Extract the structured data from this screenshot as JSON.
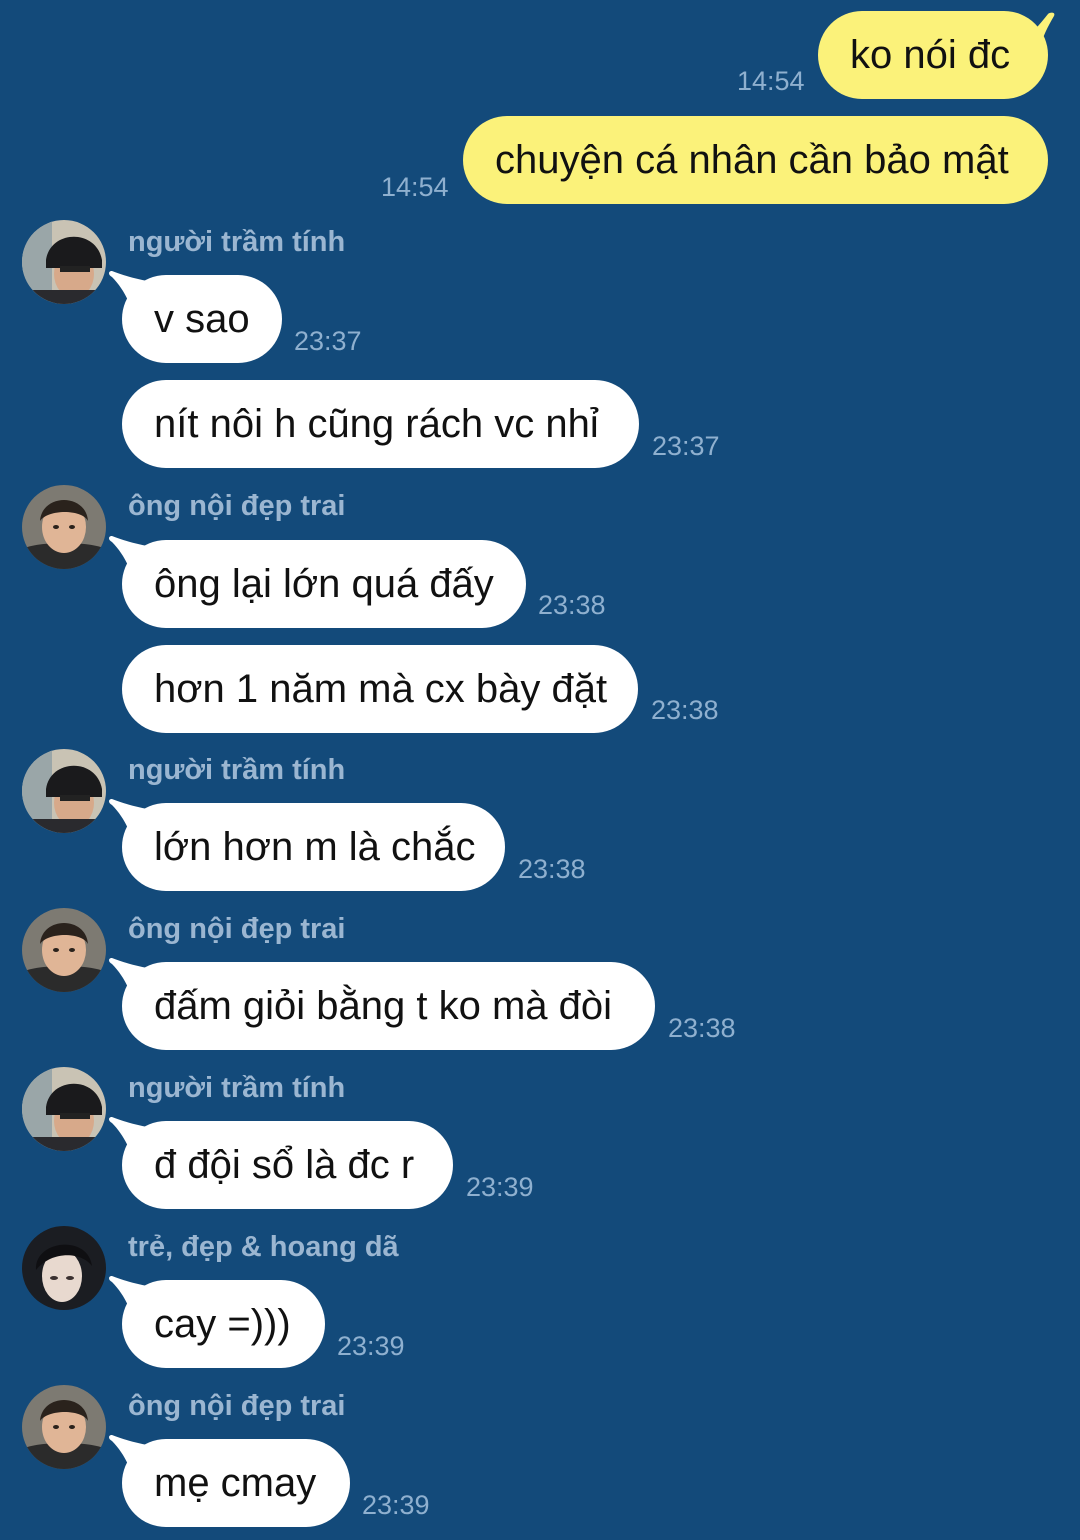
{
  "senders": {
    "a": "người trầm tính",
    "b": "ông nội đẹp trai",
    "c": "trẻ, đẹp & hoang dã"
  },
  "messages": [
    {
      "direction": "out",
      "text": "ko nói đc",
      "time": "14:54"
    },
    {
      "direction": "out",
      "text": "chuyện cá nhân cần bảo mật",
      "time": "14:54"
    },
    {
      "direction": "in",
      "sender": "người trầm tính",
      "text": "v sao",
      "time": "23:37"
    },
    {
      "direction": "in",
      "text": "nít nôi h cũng rách vc nhỉ",
      "time": "23:37"
    },
    {
      "direction": "in",
      "sender": "ông nội đẹp trai",
      "text": "ông lại lớn quá đấy",
      "time": "23:38"
    },
    {
      "direction": "in",
      "text": "hơn 1 năm mà cx bày đặt",
      "time": "23:38"
    },
    {
      "direction": "in",
      "sender": "người trầm tính",
      "text": "lớn hơn m là chắc",
      "time": "23:38"
    },
    {
      "direction": "in",
      "sender": "ông nội đẹp trai",
      "text": "đấm giỏi bằng t ko mà đòi",
      "time": "23:38"
    },
    {
      "direction": "in",
      "sender": "người trầm tính",
      "text": "đ đội sổ là đc r",
      "time": "23:39"
    },
    {
      "direction": "in",
      "sender": "trẻ, đẹp & hoang dã",
      "text": "cay =)))",
      "time": "23:39"
    },
    {
      "direction": "in",
      "sender": "ông nội đẹp trai",
      "text": "mẹ cmay",
      "time": "23:39"
    }
  ],
  "colors": {
    "background": "#134a7a",
    "incoming_bubble": "#ffffff",
    "outgoing_bubble": "#fbf27a",
    "timestamp": "#8fb0cf",
    "sender_name": "#9bb6d1"
  }
}
